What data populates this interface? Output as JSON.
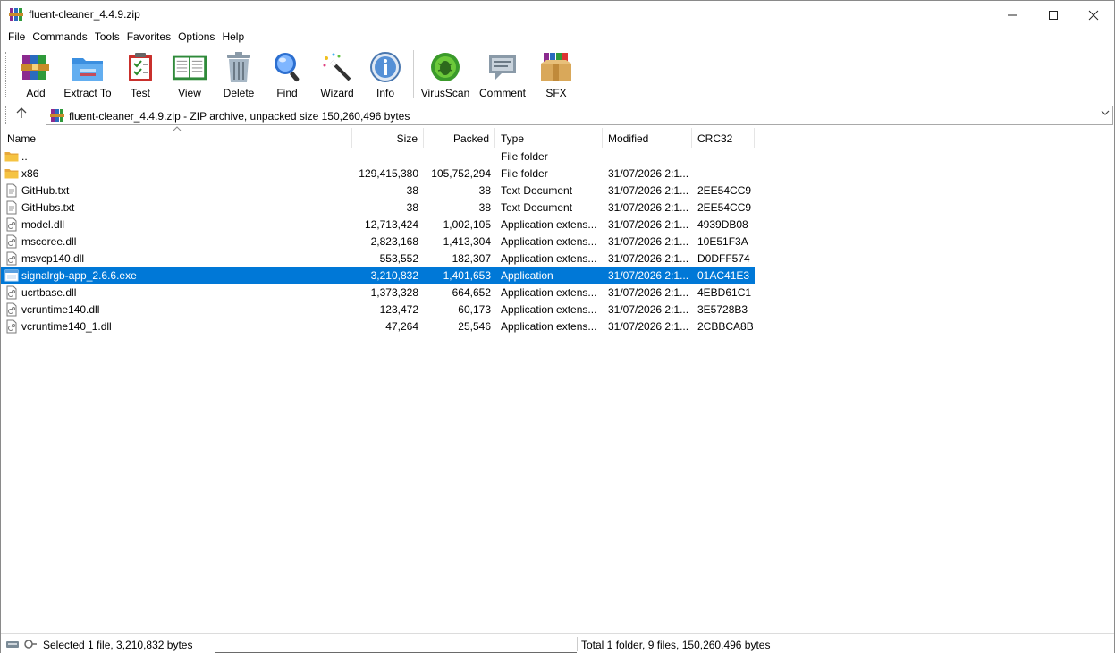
{
  "window": {
    "title": "fluent-cleaner_4.4.9.zip",
    "minimize_glyph": "—",
    "maximize_glyph": "☐",
    "close_glyph": "✕"
  },
  "menu": [
    {
      "label": "File"
    },
    {
      "label": "Commands"
    },
    {
      "label": "Tools"
    },
    {
      "label": "Favorites"
    },
    {
      "label": "Options"
    },
    {
      "label": "Help"
    }
  ],
  "toolbar": [
    {
      "id": "add",
      "label": "Add",
      "icon": "books-add-icon"
    },
    {
      "id": "extract",
      "label": "Extract To",
      "icon": "folder-extract-icon"
    },
    {
      "id": "test",
      "label": "Test",
      "icon": "clipboard-check-icon"
    },
    {
      "id": "view",
      "label": "View",
      "icon": "open-book-icon"
    },
    {
      "id": "delete",
      "label": "Delete",
      "icon": "trash-icon"
    },
    {
      "id": "find",
      "label": "Find",
      "icon": "magnifier-icon"
    },
    {
      "id": "wizard",
      "label": "Wizard",
      "icon": "magic-wand-icon"
    },
    {
      "id": "info",
      "label": "Info",
      "icon": "info-icon"
    },
    {
      "id": "virusscan",
      "label": "VirusScan",
      "icon": "bug-icon"
    },
    {
      "id": "comment",
      "label": "Comment",
      "icon": "comment-icon"
    },
    {
      "id": "sfx",
      "label": "SFX",
      "icon": "box-icon"
    }
  ],
  "address": {
    "text": "fluent-cleaner_4.4.9.zip - ZIP archive, unpacked size 150,260,496 bytes",
    "up_glyph": "↑",
    "dropdown_glyph": "⌵"
  },
  "columns": {
    "name": "Name",
    "size": "Size",
    "packed": "Packed",
    "type": "Type",
    "modified": "Modified",
    "crc": "CRC32"
  },
  "sort_caret": "^",
  "files": [
    {
      "name": "..",
      "size": "",
      "packed": "",
      "type": "File folder",
      "modified": "",
      "crc": "",
      "kind": "folder"
    },
    {
      "name": "x86",
      "size": "129,415,380",
      "packed": "105,752,294",
      "type": "File folder",
      "modified": "31/07/2026 2:1...",
      "crc": "",
      "kind": "folder"
    },
    {
      "name": "GitHub.txt",
      "size": "38",
      "packed": "38",
      "type": "Text Document",
      "modified": "31/07/2026 2:1...",
      "crc": "2EE54CC9",
      "kind": "text"
    },
    {
      "name": "GitHubs.txt",
      "size": "38",
      "packed": "38",
      "type": "Text Document",
      "modified": "31/07/2026 2:1...",
      "crc": "2EE54CC9",
      "kind": "text"
    },
    {
      "name": "model.dll",
      "size": "12,713,424",
      "packed": "1,002,105",
      "type": "Application extens...",
      "modified": "31/07/2026 2:1...",
      "crc": "4939DB08",
      "kind": "dll"
    },
    {
      "name": "mscoree.dll",
      "size": "2,823,168",
      "packed": "1,413,304",
      "type": "Application extens...",
      "modified": "31/07/2026 2:1...",
      "crc": "10E51F3A",
      "kind": "dll"
    },
    {
      "name": "msvcp140.dll",
      "size": "553,552",
      "packed": "182,307",
      "type": "Application extens...",
      "modified": "31/07/2026 2:1...",
      "crc": "D0DFF574",
      "kind": "dll"
    },
    {
      "name": "signalrgb-app_2.6.6.exe",
      "size": "3,210,832",
      "packed": "1,401,653",
      "type": "Application",
      "modified": "31/07/2026 2:1...",
      "crc": "01AC41E3",
      "kind": "exe",
      "selected": true
    },
    {
      "name": "ucrtbase.dll",
      "size": "1,373,328",
      "packed": "664,652",
      "type": "Application extens...",
      "modified": "31/07/2026 2:1...",
      "crc": "4EBD61C1",
      "kind": "dll"
    },
    {
      "name": "vcruntime140.dll",
      "size": "123,472",
      "packed": "60,173",
      "type": "Application extens...",
      "modified": "31/07/2026 2:1...",
      "crc": "3E5728B3",
      "kind": "dll"
    },
    {
      "name": "vcruntime140_1.dll",
      "size": "47,264",
      "packed": "25,546",
      "type": "Application extens...",
      "modified": "31/07/2026 2:1...",
      "crc": "2CBBCA8B",
      "kind": "dll"
    }
  ],
  "status": {
    "left": "Selected 1 file, 3,210,832 bytes",
    "right": "Total 1 folder, 9 files, 150,260,496 bytes"
  },
  "colors": {
    "selection": "#0078d7",
    "folder": "#f5c342"
  }
}
